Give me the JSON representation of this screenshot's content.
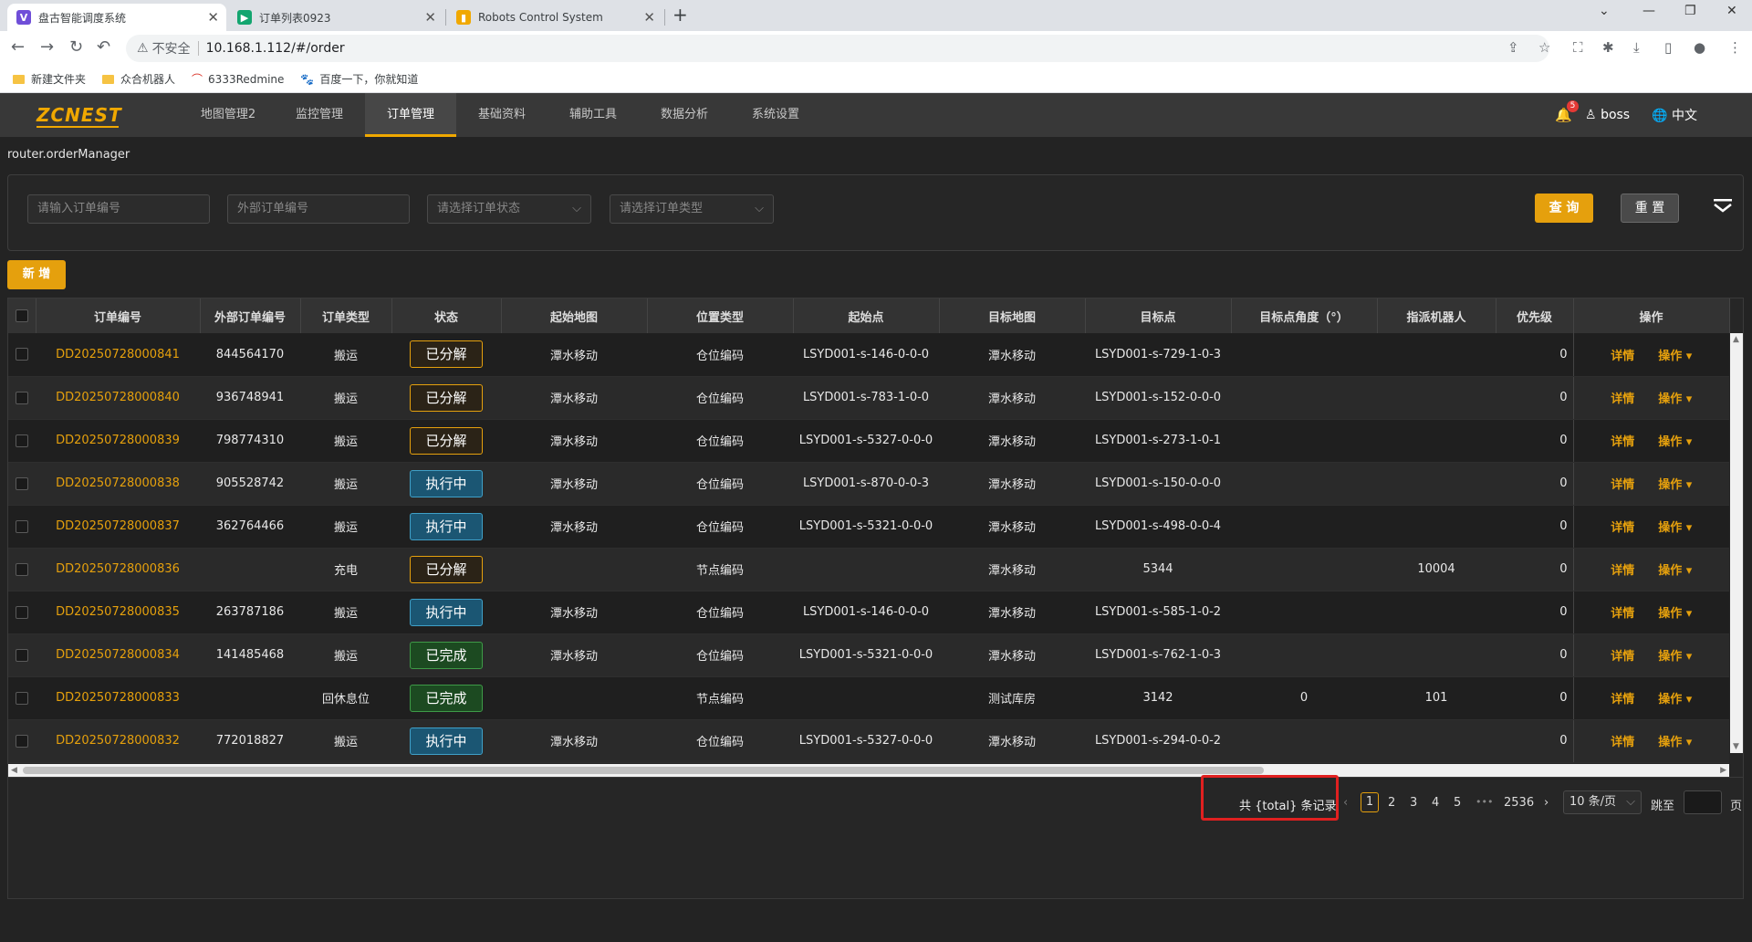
{
  "browser": {
    "tabs": [
      {
        "title": "盘古智能调度系统",
        "fav": "V",
        "fav_color": "#6f4ed8"
      },
      {
        "title": "订单列表0923",
        "fav": "▶",
        "fav_color": "#13a56f"
      },
      {
        "title": "Robots Control System",
        "fav": "▮",
        "fav_color": "#f0a800"
      }
    ],
    "address": {
      "insecure_label": "不安全",
      "url": "10.168.1.112/#/order"
    },
    "bookmarks": [
      "新建文件夹",
      "众合机器人",
      "6333Redmine",
      "百度一下，你就知道"
    ]
  },
  "app": {
    "logo": "ZCNEST",
    "nav": [
      "地图管理2",
      "监控管理",
      "订单管理",
      "基础资料",
      "辅助工具",
      "数据分析",
      "系统设置"
    ],
    "active_nav": 2,
    "bell_count": "5",
    "user": "boss",
    "lang": "中文"
  },
  "breadcrumb": "router.orderManager",
  "filter": {
    "order_no_placeholder": "请输入订单编号",
    "ext_no_placeholder": "外部订单编号",
    "status_placeholder": "请选择订单状态",
    "type_placeholder": "请选择订单类型",
    "query_label": "查 询",
    "reset_label": "重 置"
  },
  "add_label": "新 增",
  "table": {
    "headers": [
      "订单编号",
      "外部订单编号",
      "订单类型",
      "状态",
      "起始地图",
      "位置类型",
      "起始点",
      "目标地图",
      "目标点",
      "目标点角度（°）",
      "指派机器人",
      "优先级",
      "操作"
    ],
    "detail_label": "详情",
    "op_label": "操作",
    "rows": [
      {
        "order": "DD20250728000841",
        "ext": "844564170",
        "type": "搬运",
        "status": "已分解",
        "smap": "潭水移动",
        "ptype": "仓位编码",
        "start": "LSYD001-s-146-0-0-0",
        "tmap": "潭水移动",
        "target": "LSYD001-s-729-1-0-3",
        "angle": "",
        "robot": "",
        "prio": "0"
      },
      {
        "order": "DD20250728000840",
        "ext": "936748941",
        "type": "搬运",
        "status": "已分解",
        "smap": "潭水移动",
        "ptype": "仓位编码",
        "start": "LSYD001-s-783-1-0-0",
        "tmap": "潭水移动",
        "target": "LSYD001-s-152-0-0-0",
        "angle": "",
        "robot": "",
        "prio": "0"
      },
      {
        "order": "DD20250728000839",
        "ext": "798774310",
        "type": "搬运",
        "status": "已分解",
        "smap": "潭水移动",
        "ptype": "仓位编码",
        "start": "LSYD001-s-5327-0-0-0",
        "tmap": "潭水移动",
        "target": "LSYD001-s-273-1-0-1",
        "angle": "",
        "robot": "",
        "prio": "0"
      },
      {
        "order": "DD20250728000838",
        "ext": "905528742",
        "type": "搬运",
        "status": "执行中",
        "smap": "潭水移动",
        "ptype": "仓位编码",
        "start": "LSYD001-s-870-0-0-3",
        "tmap": "潭水移动",
        "target": "LSYD001-s-150-0-0-0",
        "angle": "",
        "robot": "",
        "prio": "0"
      },
      {
        "order": "DD20250728000837",
        "ext": "362764466",
        "type": "搬运",
        "status": "执行中",
        "smap": "潭水移动",
        "ptype": "仓位编码",
        "start": "LSYD001-s-5321-0-0-0",
        "tmap": "潭水移动",
        "target": "LSYD001-s-498-0-0-4",
        "angle": "",
        "robot": "",
        "prio": "0"
      },
      {
        "order": "DD20250728000836",
        "ext": "",
        "type": "充电",
        "status": "已分解",
        "smap": "",
        "ptype": "节点编码",
        "start": "",
        "tmap": "潭水移动",
        "target": "5344",
        "angle": "",
        "robot": "10004",
        "prio": "0"
      },
      {
        "order": "DD20250728000835",
        "ext": "263787186",
        "type": "搬运",
        "status": "执行中",
        "smap": "潭水移动",
        "ptype": "仓位编码",
        "start": "LSYD001-s-146-0-0-0",
        "tmap": "潭水移动",
        "target": "LSYD001-s-585-1-0-2",
        "angle": "",
        "robot": "",
        "prio": "0"
      },
      {
        "order": "DD20250728000834",
        "ext": "141485468",
        "type": "搬运",
        "status": "已完成",
        "smap": "潭水移动",
        "ptype": "仓位编码",
        "start": "LSYD001-s-5321-0-0-0",
        "tmap": "潭水移动",
        "target": "LSYD001-s-762-1-0-3",
        "angle": "",
        "robot": "",
        "prio": "0"
      },
      {
        "order": "DD20250728000833",
        "ext": "",
        "type": "回休息位",
        "status": "已完成",
        "smap": "",
        "ptype": "节点编码",
        "start": "",
        "tmap": "测试库房",
        "target": "3142",
        "angle": "0",
        "robot": "101",
        "prio": "0"
      },
      {
        "order": "DD20250728000832",
        "ext": "772018827",
        "type": "搬运",
        "status": "执行中",
        "smap": "潭水移动",
        "ptype": "仓位编码",
        "start": "LSYD001-s-5327-0-0-0",
        "tmap": "潭水移动",
        "target": "LSYD001-s-294-0-0-2",
        "angle": "",
        "robot": "",
        "prio": "0"
      }
    ]
  },
  "pagination": {
    "total_text": "共 {total} 条记录",
    "pages": [
      "1",
      "2",
      "3",
      "4",
      "5"
    ],
    "ellipsis": "•••",
    "last_page": "2536",
    "page_size": "10 条/页",
    "jump_label": "跳至",
    "page_suffix": "页"
  }
}
